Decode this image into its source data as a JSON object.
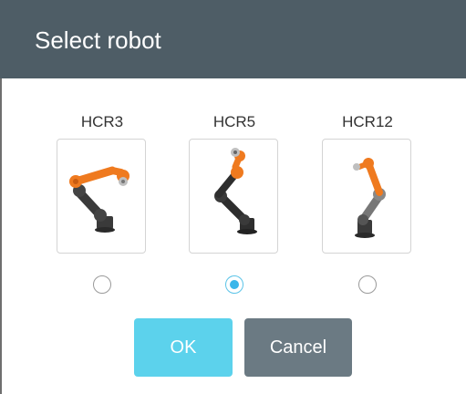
{
  "dialog": {
    "title": "Select robot"
  },
  "robots": [
    {
      "label": "HCR3",
      "image_icon": "robot-arm-hcr3",
      "selected": false
    },
    {
      "label": "HCR5",
      "image_icon": "robot-arm-hcr5",
      "selected": true
    },
    {
      "label": "HCR12",
      "image_icon": "robot-arm-hcr12",
      "selected": false
    }
  ],
  "buttons": {
    "ok_label": "OK",
    "cancel_label": "Cancel"
  },
  "colors": {
    "header_bg": "#4e5d66",
    "ok_bg": "#5cd2ec",
    "cancel_bg": "#6b7a83",
    "radio_selected": "#3ab6ea",
    "robot_orange": "#ef7a1f",
    "robot_dark": "#2e2e2e"
  }
}
